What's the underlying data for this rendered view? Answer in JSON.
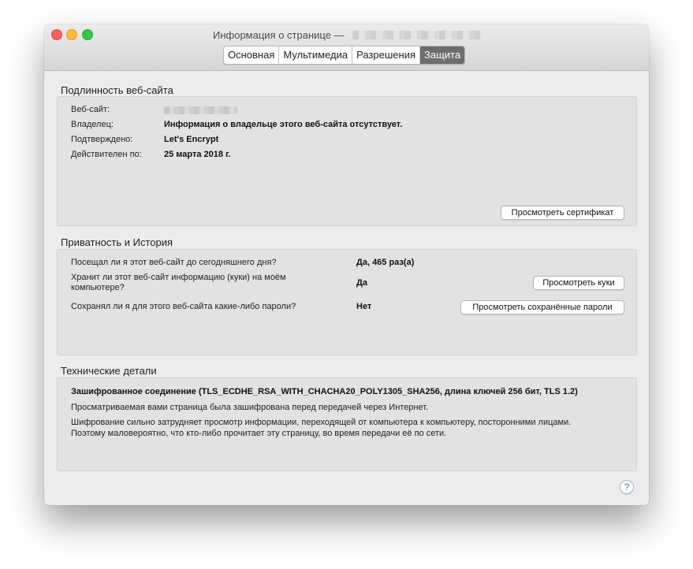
{
  "window": {
    "title": "Информация о странице —"
  },
  "tabs": [
    {
      "label": "Основная",
      "active": false
    },
    {
      "label": "Мультимедиа",
      "active": false
    },
    {
      "label": "Разрешения",
      "active": false
    },
    {
      "label": "Защита",
      "active": true
    }
  ],
  "identity": {
    "heading": "Подлинность веб-сайта",
    "rows": [
      {
        "label": "Веб-сайт:",
        "value": ""
      },
      {
        "label": "Владелец:",
        "value": "Информация о владельце этого веб-сайта отсутствует."
      },
      {
        "label": "Подтверждено:",
        "value": "Let's Encrypt"
      },
      {
        "label": "Действителен по:",
        "value": "25 марта 2018 г."
      }
    ],
    "view_certificate_button": "Просмотреть сертификат"
  },
  "privacy": {
    "heading": "Приватность и История",
    "rows": [
      {
        "question": "Посещал ли я этот веб-сайт до сегодняшнего дня?",
        "answer": "Да, 465 раз(а)"
      },
      {
        "question": "Хранит ли этот веб-сайт информацию (куки) на моём",
        "question_line2": "компьютере?",
        "answer": "Да"
      },
      {
        "question": "Сохранял ли я для этого веб-сайта какие-либо пароли?",
        "answer": "Нет"
      }
    ],
    "view_cookies_button": "Просмотреть куки",
    "view_passwords_button": "Просмотреть сохранённые пароли"
  },
  "technical": {
    "heading": "Технические детали",
    "connection": "Зашифрованное соединение (TLS_ECDHE_RSA_WITH_CHACHA20_POLY1305_SHA256, длина ключей 256 бит, TLS 1.2)",
    "line1": "Просматриваемая вами страница была зашифрована перед передачей через Интернет.",
    "line2": "Шифрование сильно затрудняет просмотр информации, переходящей от компьютера к компьютеру, посторонними лицами.",
    "line3": "Поэтому маловероятно, что кто-либо прочитает эту страницу, во время передачи её по сети."
  },
  "help": {
    "label": "?"
  },
  "colors": {
    "close": "#fc605c",
    "minimize": "#fdbc40",
    "maximize": "#34c84a",
    "active_tab": "#6d6d6d",
    "help_accent": "#2e7de1"
  }
}
